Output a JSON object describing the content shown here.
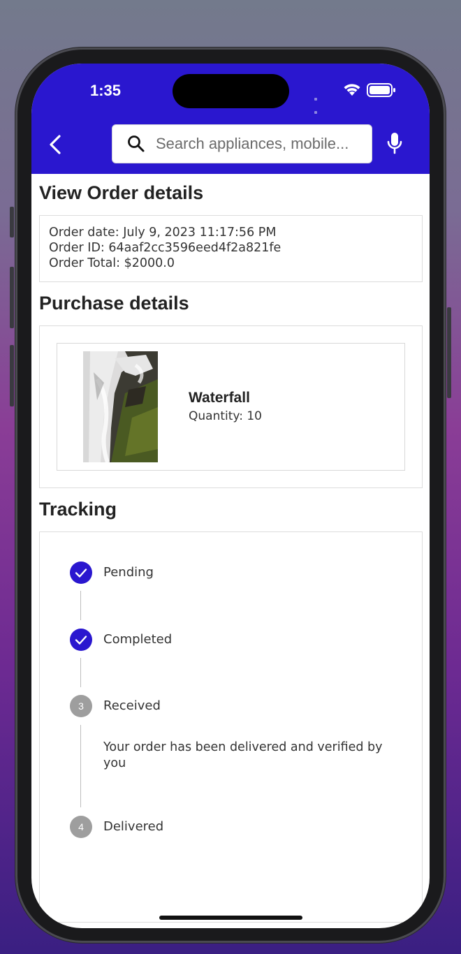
{
  "status_bar": {
    "time": "1:35"
  },
  "header": {
    "search_placeholder": "Search appliances, mobile...",
    "accent_color": "#2a17cf",
    "icons": [
      "back-chevron-icon",
      "search-icon",
      "mic-icon"
    ]
  },
  "order_details": {
    "title": "View Order details",
    "order_date": "Order date: July 9, 2023 11:17:56 PM",
    "order_id": "Order ID: 64aaf2cc3596eed4f2a821fe",
    "order_total": "Order Total: $2000.0"
  },
  "purchase": {
    "title": "Purchase details",
    "product_name": "Waterfall",
    "quantity": "Quantity: 10"
  },
  "tracking": {
    "title": "Tracking",
    "steps": [
      {
        "label": "Pending",
        "icon": "check",
        "state": "done"
      },
      {
        "label": "Completed",
        "icon": "check",
        "state": "done"
      },
      {
        "label": "Received",
        "icon": "3",
        "state": "todo",
        "description": "Your order has been delivered and verified by you"
      },
      {
        "label": "Delivered",
        "icon": "4",
        "state": "todo"
      }
    ]
  }
}
